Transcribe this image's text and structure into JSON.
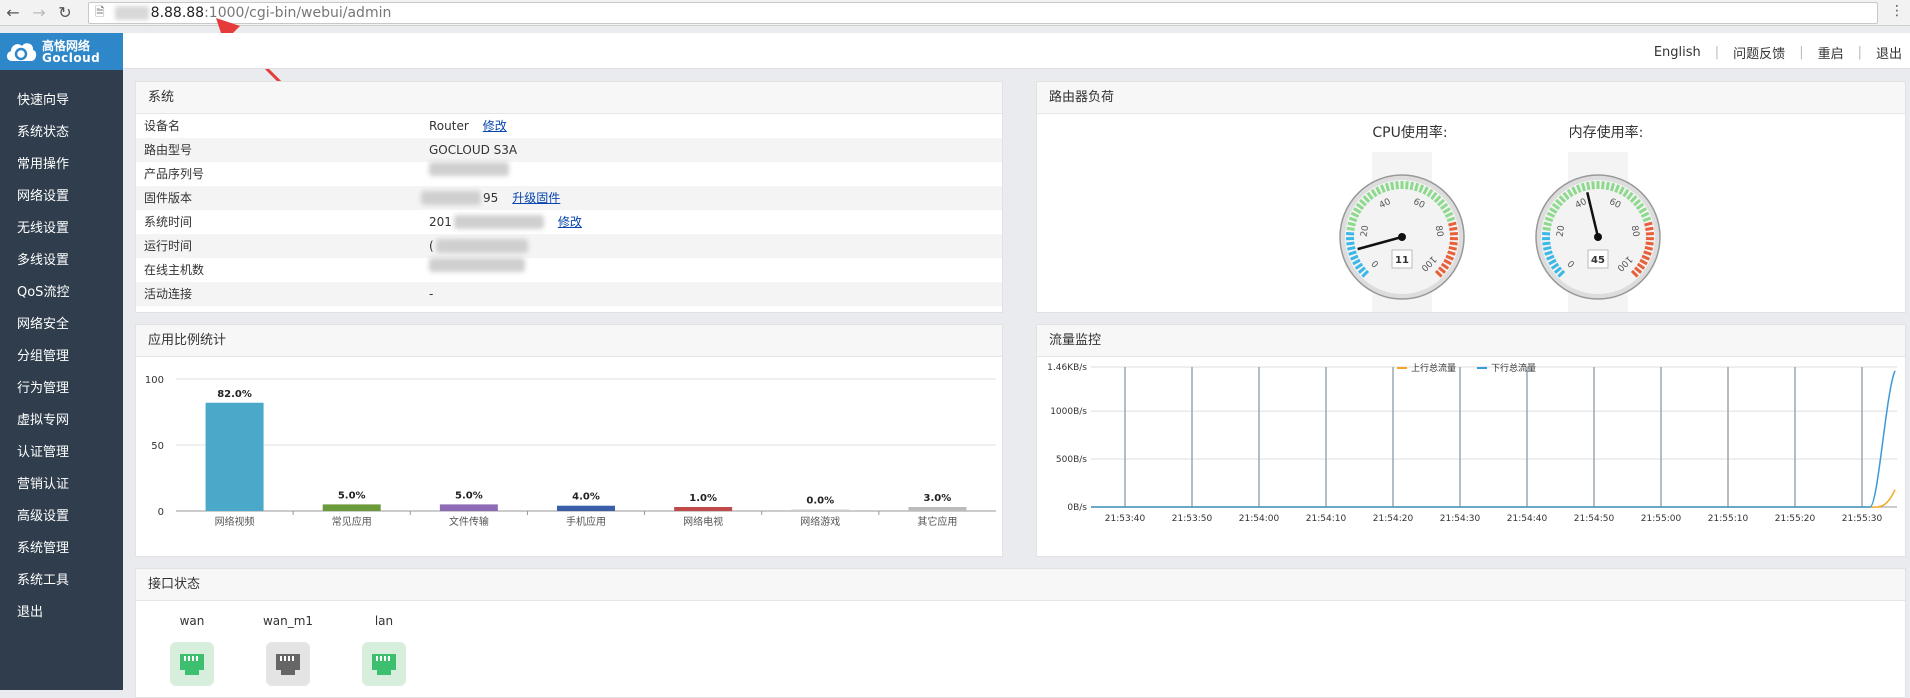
{
  "browser": {
    "url_host": "8.88.88",
    "url_port_path": ":1000/cgi-bin/webui/admin"
  },
  "logo": {
    "cn": "高恪网络",
    "en": "Gocloud"
  },
  "sidebar": {
    "items": [
      {
        "label": "快速向导"
      },
      {
        "label": "系统状态"
      },
      {
        "label": "常用操作"
      },
      {
        "label": "网络设置"
      },
      {
        "label": "无线设置"
      },
      {
        "label": "多线设置"
      },
      {
        "label": "QoS流控"
      },
      {
        "label": "网络安全"
      },
      {
        "label": "分组管理"
      },
      {
        "label": "行为管理"
      },
      {
        "label": "虚拟专网"
      },
      {
        "label": "认证管理"
      },
      {
        "label": "营销认证"
      },
      {
        "label": "高级设置"
      },
      {
        "label": "系统管理"
      },
      {
        "label": "系统工具"
      },
      {
        "label": "退出"
      }
    ]
  },
  "topnav": {
    "english": "English",
    "feedback": "问题反馈",
    "restart": "重启",
    "logout": "退出"
  },
  "system": {
    "title": "系统",
    "rows": [
      {
        "label": "设备名",
        "value": "Router",
        "link": "修改"
      },
      {
        "label": "路由型号",
        "value": "GOCLOUD S3A"
      },
      {
        "label": "产品序列号",
        "value": ""
      },
      {
        "label": "固件版本",
        "value": "95",
        "link": "升级固件"
      },
      {
        "label": "系统时间",
        "value": "201",
        "link": "修改"
      },
      {
        "label": "运行时间",
        "value": "("
      },
      {
        "label": "在线主机数",
        "value": ""
      },
      {
        "label": "活动连接",
        "value": "-"
      }
    ]
  },
  "load": {
    "title": "路由器负荷",
    "cpu_label": "CPU使用率:",
    "mem_label": "内存使用率:",
    "cpu_value": 11,
    "mem_value": 45,
    "ticks": [
      "0",
      "20",
      "40",
      "60",
      "80",
      "100"
    ]
  },
  "app_stats": {
    "title": "应用比例统计",
    "chart_data": {
      "type": "bar",
      "categories": [
        "网络视频",
        "常见应用",
        "文件传输",
        "手机应用",
        "网络电视",
        "网络游戏",
        "其它应用"
      ],
      "values": [
        82.0,
        5.0,
        5.0,
        4.0,
        1.0,
        0.0,
        3.0
      ],
      "value_labels": [
        "82.0%",
        "5.0%",
        "5.0%",
        "4.0%",
        "1.0%",
        "0.0%",
        "3.0%"
      ],
      "colors": [
        "#4aa8c9",
        "#6a9a3a",
        "#8e6bb5",
        "#3a5fa8",
        "#c04a4a",
        "#cccccc",
        "#bbbbbb"
      ],
      "yticks": [
        "100",
        "50",
        "0"
      ],
      "ylim": [
        0,
        100
      ]
    }
  },
  "traffic": {
    "title": "流量监控",
    "chart_data": {
      "type": "line",
      "x": [
        "21:53:40",
        "21:53:50",
        "21:54:00",
        "21:54:10",
        "21:54:20",
        "21:54:30",
        "21:54:40",
        "21:54:50",
        "21:55:00",
        "21:55:10",
        "21:55:20",
        "21:55:30"
      ],
      "yticks": [
        "1.46KB/s",
        "1000B/s",
        "500B/s",
        "0B/s"
      ],
      "series": [
        {
          "name": "上行总流量",
          "color": "#f5a623",
          "end_value_bps": 180
        },
        {
          "name": "下行总流量",
          "color": "#3a9ad9",
          "end_value_bps": 1420
        }
      ]
    }
  },
  "interfaces": {
    "title": "接口状态",
    "items": [
      {
        "name": "wan",
        "status": "up"
      },
      {
        "name": "wan_m1",
        "status": "down"
      },
      {
        "name": "lan",
        "status": "up"
      }
    ]
  }
}
